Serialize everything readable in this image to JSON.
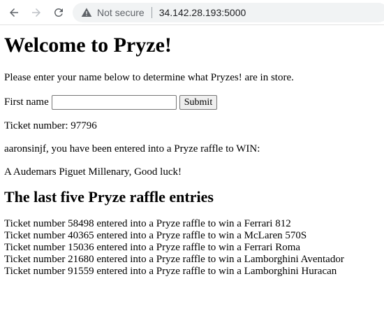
{
  "browser": {
    "security_label": "Not secure",
    "url": "34.142.28.193:5000"
  },
  "page": {
    "title": "Welcome to Pryze!",
    "intro": "Please enter your name below to determine what Pryzes! are in store.",
    "form": {
      "label": "First name",
      "input_value": "",
      "submit_label": "Submit"
    },
    "ticket_line": "Ticket number: 97796",
    "entered_line": "aaronsinjf, you have been entered into a Pryze raffle to WIN:",
    "prize_line": "A Audemars Piguet Millenary, Good luck!",
    "entries_heading": "The last five Pryze raffle entries",
    "entries": [
      "Ticket number 58498 entered into a Pryze raffle to win a Ferrari 812",
      "Ticket number 40365 entered into a Pryze raffle to win a McLaren 570S",
      "Ticket number 15036 entered into a Pryze raffle to win a Ferrari Roma",
      "Ticket number 21680 entered into a Pryze raffle to win a Lamborghini Aventador",
      "Ticket number 91559 entered into a Pryze raffle to win a Lamborghini Huracan"
    ]
  },
  "icons": {
    "back": "arrow-left-icon",
    "forward": "arrow-right-icon",
    "reload": "reload-icon",
    "security": "warning-triangle-icon"
  },
  "colors": {
    "nav_icon": "#5f6368",
    "forward_disabled": "#bdc1c6",
    "omnibox_bg": "#f1f3f4"
  }
}
